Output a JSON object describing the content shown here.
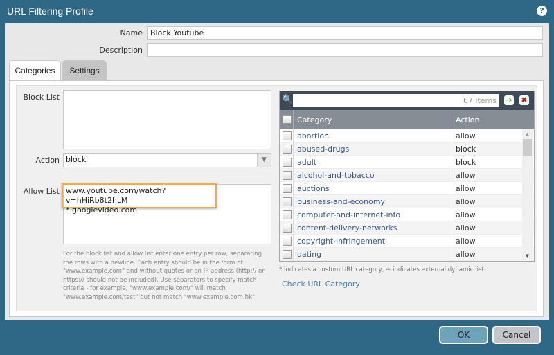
{
  "title": "URL Filtering Profile",
  "form": {
    "name_label": "Name",
    "name_value": "Block Youtube",
    "description_label": "Description",
    "description_value": ""
  },
  "tabs": [
    {
      "label": "Categories"
    },
    {
      "label": "Settings"
    }
  ],
  "block_list": {
    "label": "Block List",
    "value": ""
  },
  "action": {
    "label": "Action",
    "value": "block"
  },
  "allow_list": {
    "label": "Allow List",
    "lines": [
      "www.youtube.com/watch?v=hHiRb8t2hLM",
      "*.googlevideo.com"
    ]
  },
  "help_text": "For the block list and allow list enter one entry per row, separating the rows with a newline. Each entry should be in the form of \"www.example.com\" and without quotes or an IP address (http:// or https:// should not be included). Use separators to specify match criteria - for example, \"www.example.com/\" will match \"www.example.com/test\" but not match \"www.example.com.hk\"",
  "grid": {
    "search_placeholder": "67 items",
    "columns": [
      "Category",
      "Action"
    ],
    "rows": [
      [
        "abortion",
        "allow"
      ],
      [
        "abused-drugs",
        "block"
      ],
      [
        "adult",
        "block"
      ],
      [
        "alcohol-and-tobacco",
        "allow"
      ],
      [
        "auctions",
        "allow"
      ],
      [
        "business-and-economy",
        "allow"
      ],
      [
        "computer-and-internet-info",
        "allow"
      ],
      [
        "content-delivery-networks",
        "allow"
      ],
      [
        "copyright-infringement",
        "allow"
      ],
      [
        "dating",
        "allow"
      ]
    ]
  },
  "footnote": "* indicates a custom URL category, + indicates external dynamic list",
  "check_link": "Check URL Category",
  "buttons": {
    "ok": "OK",
    "cancel": "Cancel"
  }
}
